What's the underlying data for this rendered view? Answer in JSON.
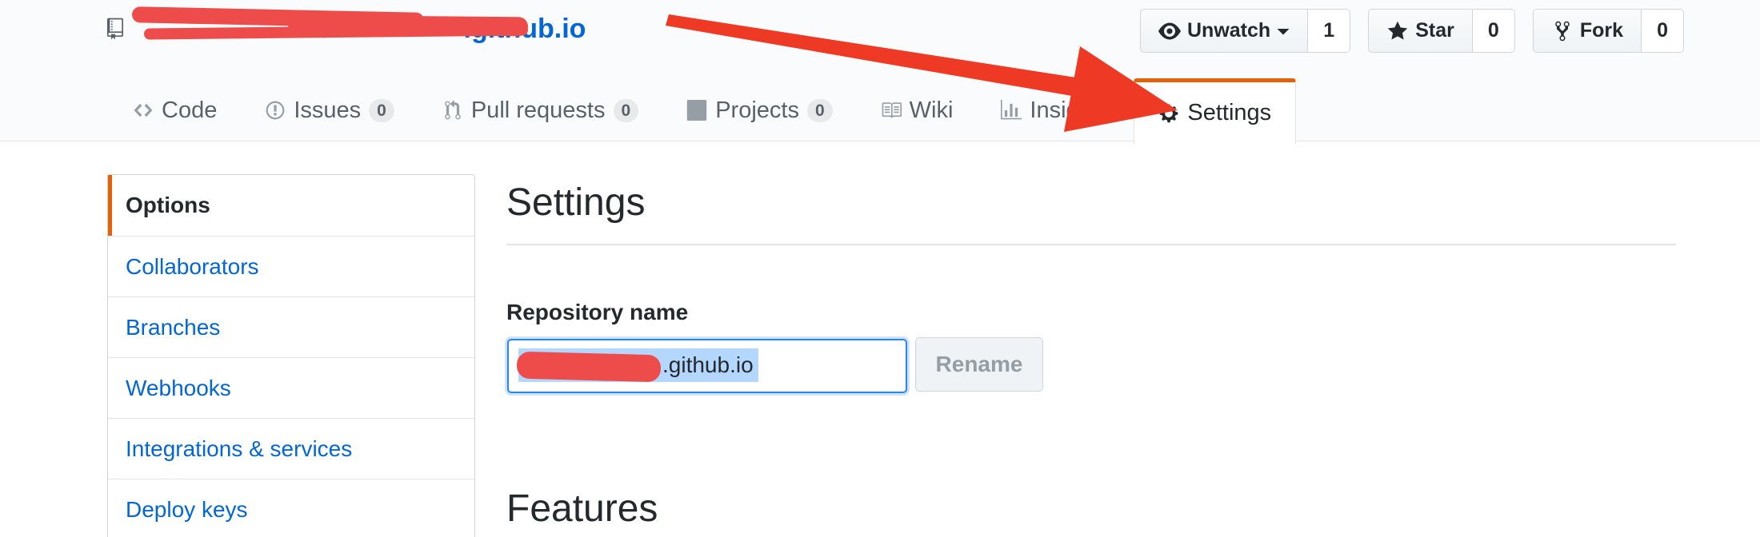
{
  "repo": {
    "owner": "",
    "separator": "/",
    "name": ".github.io"
  },
  "actions": {
    "watch": {
      "label": "Unwatch",
      "count": "1"
    },
    "star": {
      "label": "Star",
      "count": "0"
    },
    "fork": {
      "label": "Fork",
      "count": "0"
    }
  },
  "tabs": [
    {
      "label": "Code",
      "icon": "code-icon"
    },
    {
      "label": "Issues",
      "count": "0",
      "icon": "issue-icon"
    },
    {
      "label": "Pull requests",
      "count": "0",
      "icon": "pull-request-icon"
    },
    {
      "label": "Projects",
      "count": "0",
      "icon": "project-icon"
    },
    {
      "label": "Wiki",
      "icon": "book-icon"
    },
    {
      "label": "Insights",
      "icon": "graph-icon"
    },
    {
      "label": "Settings",
      "icon": "gear-icon",
      "selected": true
    }
  ],
  "sidebar": {
    "items": [
      {
        "label": "Options",
        "selected": true
      },
      {
        "label": "Collaborators"
      },
      {
        "label": "Branches"
      },
      {
        "label": "Webhooks"
      },
      {
        "label": "Integrations & services"
      },
      {
        "label": "Deploy keys"
      }
    ]
  },
  "main": {
    "title": "Settings",
    "repo_name_label": "Repository name",
    "repo_name_value": ".github.io",
    "rename_label": "Rename",
    "features_title": "Features"
  },
  "colors": {
    "link": "#0366d6",
    "accent": "#e36209",
    "annotation": "#ee3a24",
    "redaction": "#ee4b4b"
  }
}
